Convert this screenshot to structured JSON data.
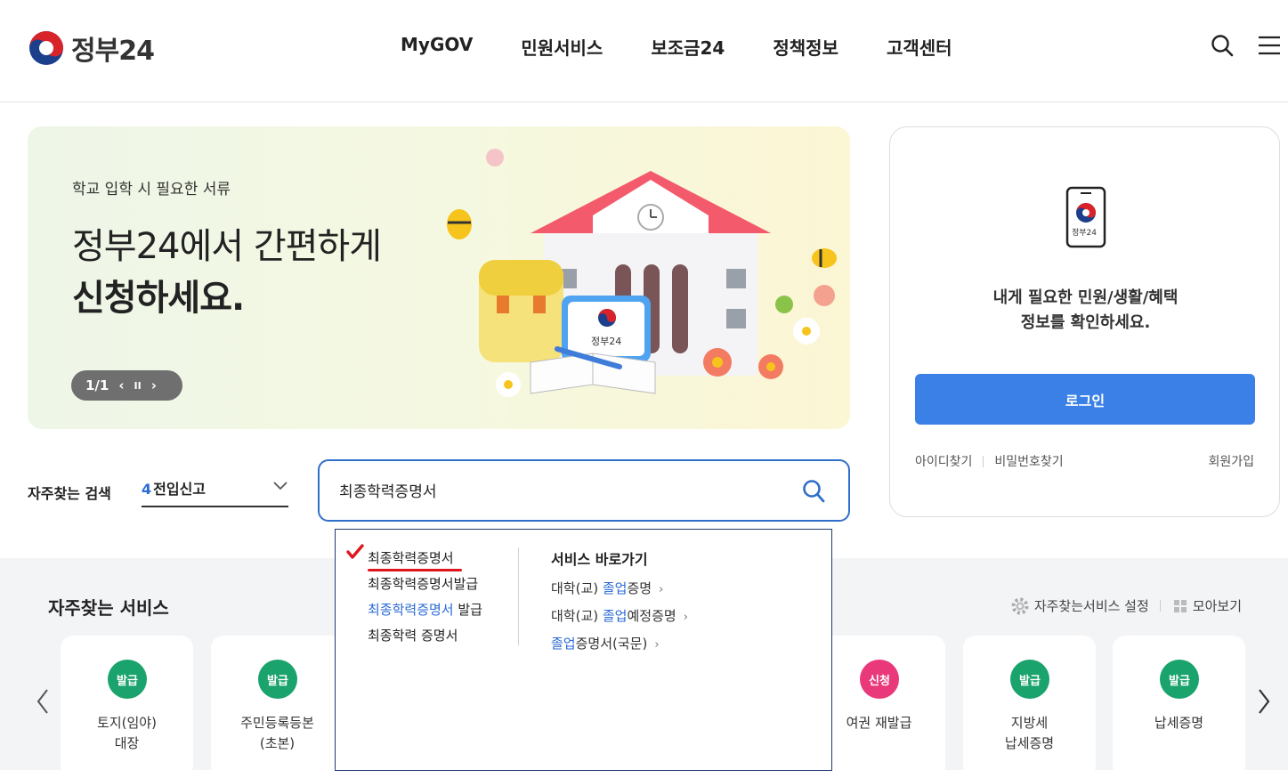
{
  "header": {
    "logo_text": "정부24",
    "nav": [
      "MyGOV",
      "민원서비스",
      "보조금24",
      "정책정보",
      "고객센터"
    ],
    "icons": [
      "search-icon",
      "menu-icon"
    ]
  },
  "banner": {
    "subtitle": "학교 입학 시 필요한 서류",
    "title_line1": "정부24에서 간편하게",
    "title_line2": "신청하세요.",
    "pager": "1/1",
    "device_label": "정부24"
  },
  "login": {
    "phone_label": "정부24",
    "message_line1": "내게 필요한 민원/생활/혜택",
    "message_line2": "정보를 확인하세요.",
    "button": "로그인",
    "find_id": "아이디찾기",
    "find_pw": "비밀번호찾기",
    "signup": "회원가입"
  },
  "frequent_search": {
    "label": "자주찾는 검색",
    "rank": "4",
    "term": "전입신고"
  },
  "search": {
    "value": "최종학력증명서"
  },
  "autocomplete": {
    "suggestions": [
      {
        "pre": "",
        "hl": "",
        "post": "최종학력증명서"
      },
      {
        "pre": "",
        "hl": "",
        "post": "최종학력증명서발급"
      },
      {
        "pre": "",
        "hl": "최종학력증명서",
        "post": " 발급"
      },
      {
        "pre": "",
        "hl": "",
        "post": "최종학력 증명서"
      }
    ],
    "shortcut_title": "서비스 바로가기",
    "shortcuts": [
      {
        "pre": "대학(교) ",
        "hl": "졸업",
        "post": "증명"
      },
      {
        "pre": "대학(교) ",
        "hl": "졸업",
        "post": "예정증명"
      },
      {
        "pre": "",
        "hl": "졸업",
        "post": "증명서(국문)"
      }
    ]
  },
  "services": {
    "title": "자주찾는 서비스",
    "settings": "자주찾는서비스 설정",
    "view_all": "모아보기",
    "cards": [
      {
        "badge": "발급",
        "color": "green",
        "label": "토지(임야)\n대장"
      },
      {
        "badge": "발급",
        "color": "green",
        "label": "주민등록등본\n(초본)"
      },
      {
        "badge": "신청",
        "color": "pink",
        "label": "여권 재발급"
      },
      {
        "badge": "발급",
        "color": "green",
        "label": "지방세\n납세증명"
      },
      {
        "badge": "발급",
        "color": "green",
        "label": "납세증명"
      }
    ]
  },
  "colors": {
    "primary": "#3a80e6",
    "search_border": "#2f6fc9",
    "badge_green": "#1aa36c",
    "badge_pink": "#e9397a",
    "underline_red": "#e0161e"
  }
}
